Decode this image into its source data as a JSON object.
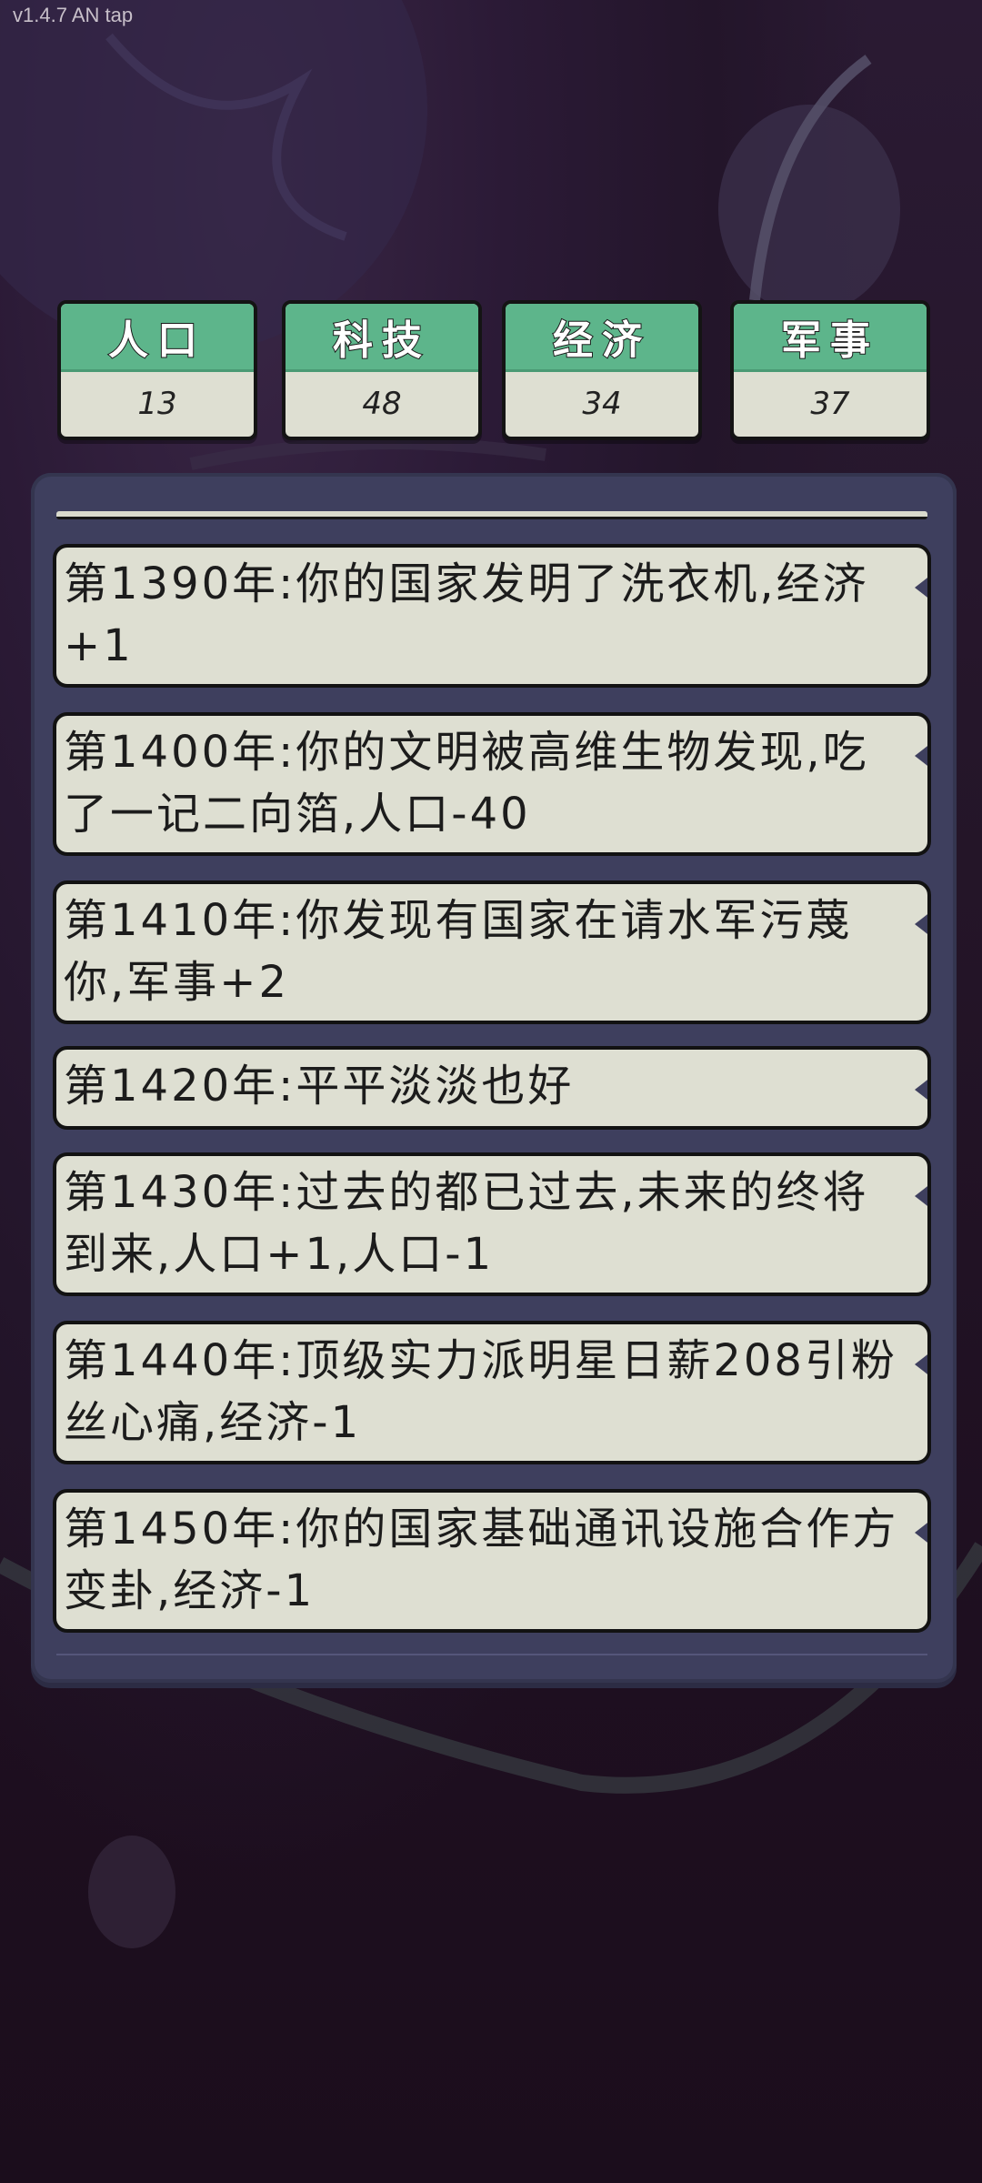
{
  "version": "v1.4.7 AN tap",
  "stats": [
    {
      "label": "人口",
      "value": "13"
    },
    {
      "label": "科技",
      "value": "48"
    },
    {
      "label": "经济",
      "value": "34"
    },
    {
      "label": "军事",
      "value": "37"
    }
  ],
  "events": [
    {
      "text": "第1390年:你的国家发明了洗衣机,经济+1"
    },
    {
      "text": "第1400年:你的文明被高维生物发现,吃了一记二向箔,人口-40"
    },
    {
      "text": "第1410年:你发现有国家在请水军污蔑你,军事+2"
    },
    {
      "text": "第1420年:平平淡淡也好"
    },
    {
      "text": "第1430年:过去的都已过去,未来的终将到来,人口+1,人口-1"
    },
    {
      "text": "第1440年:顶级实力派明星日薪208引粉丝心痛,经济-1"
    },
    {
      "text": "第1450年:你的国家基础通讯设施合作方变卦,经济-1"
    }
  ]
}
